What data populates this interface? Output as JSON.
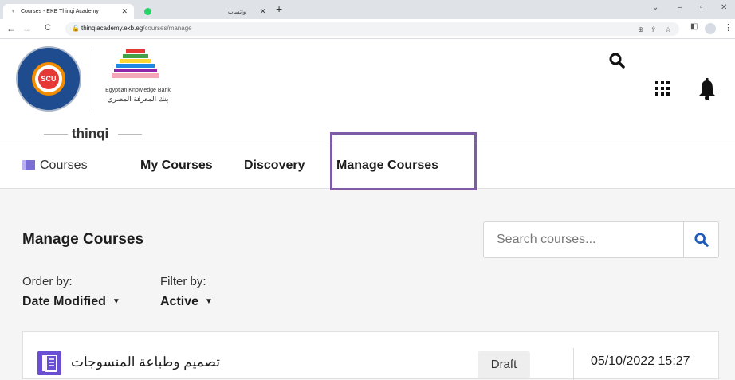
{
  "browser": {
    "tabs": [
      {
        "label": "Courses - EKB Thinqi Academy"
      },
      {
        "label": "واتساب"
      }
    ],
    "url_host": "thinqiacademy.ekb.eg",
    "url_path": "/courses/manage"
  },
  "header": {
    "logo_scu_text": "SCU",
    "ekb_english": "Egyptian Knowledge Bank",
    "ekb_arabic": "بنك المعرفة المصري",
    "brand": "thinqi"
  },
  "nav": {
    "courses_label": "Courses",
    "my_courses": "My Courses",
    "discovery": "Discovery",
    "manage_courses": "Manage Courses"
  },
  "main": {
    "title": "Manage Courses",
    "search_placeholder": "Search courses...",
    "order_label": "Order by:",
    "order_value": "Date Modified",
    "filter_label": "Filter by:",
    "filter_value": "Active"
  },
  "courses": [
    {
      "title": "تصميم وطباعة المنسوجات",
      "status": "Draft",
      "modified": "05/10/2022 15:27"
    }
  ],
  "colors": {
    "highlight": "#7d5ba6",
    "accent": "#6a4fd4",
    "search_icon": "#1e5bb8"
  }
}
